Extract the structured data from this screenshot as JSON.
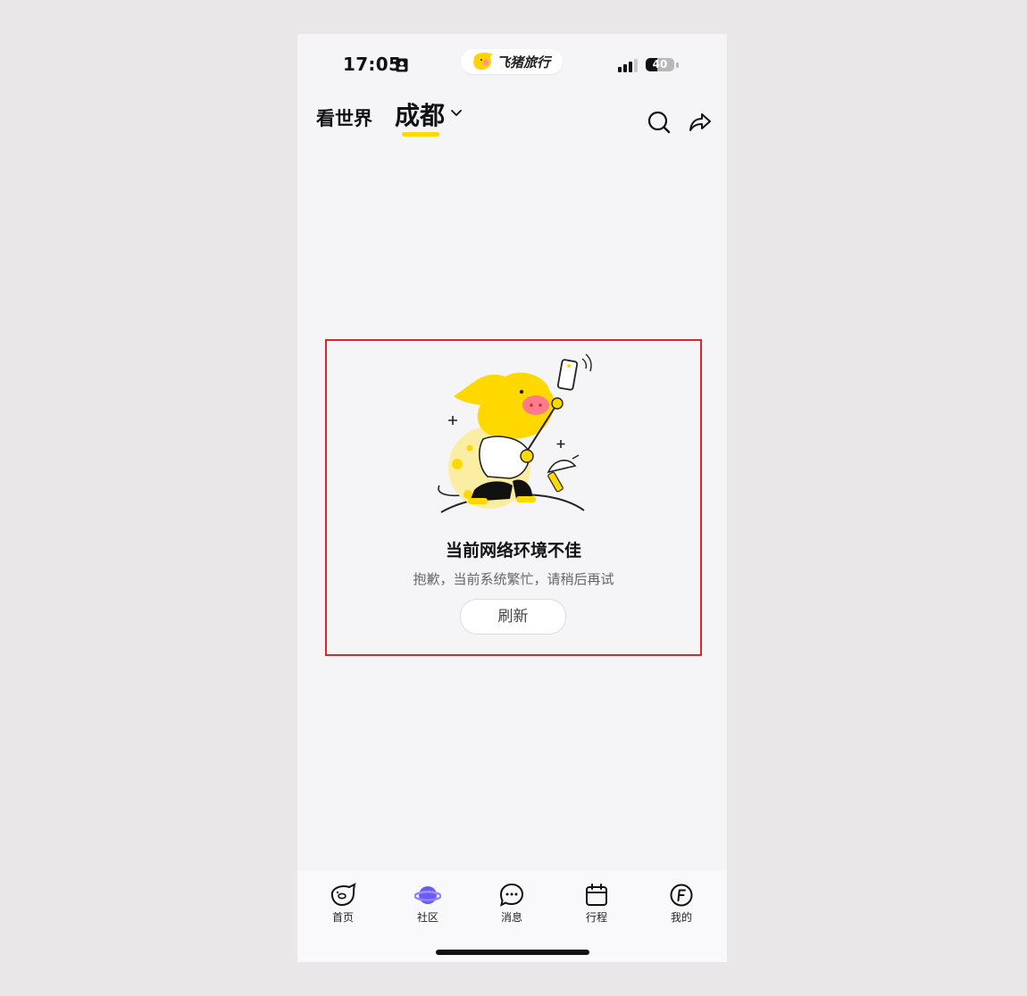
{
  "status_bar": {
    "time": "17:05",
    "battery_percent": "40",
    "app_name": "飞猪旅行"
  },
  "header": {
    "tabs": [
      {
        "label": "看世界",
        "selected": false
      },
      {
        "label": "成都",
        "selected": true
      }
    ],
    "icons": [
      "search-icon",
      "share-icon",
      "chevron-down-icon"
    ]
  },
  "error": {
    "title": "当前网络环境不佳",
    "subtitle": "抱歉，当前系统繁忙，请稍后再试",
    "refresh_label": "刷新"
  },
  "tabbar": {
    "items": [
      {
        "label": "首页",
        "icon": "pig-home-icon"
      },
      {
        "label": "社区",
        "icon": "planet-icon",
        "active": true
      },
      {
        "label": "消息",
        "icon": "message-icon"
      },
      {
        "label": "行程",
        "icon": "calendar-icon"
      },
      {
        "label": "我的",
        "icon": "profile-f-icon"
      }
    ]
  },
  "colors": {
    "accent_yellow": "#ffd800",
    "highlight_border": "#e0242b",
    "community_purple": "#6b5cf6",
    "background": "#f5f5f8"
  }
}
